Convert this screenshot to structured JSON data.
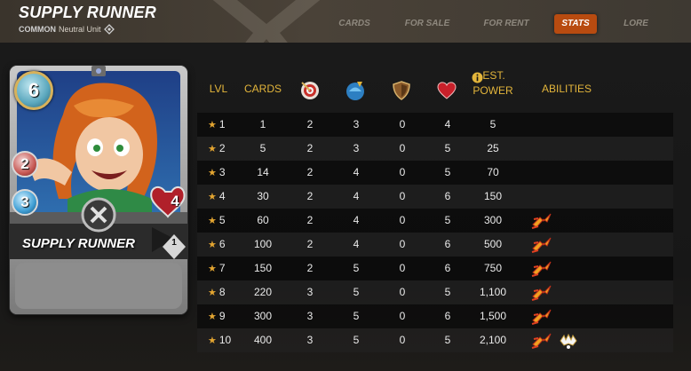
{
  "header": {
    "title": "SUPPLY RUNNER",
    "rarity": "COMMON",
    "unit_type": "Neutral Unit"
  },
  "tabs": [
    {
      "label": "CARDS",
      "active": false
    },
    {
      "label": "FOR SALE",
      "active": false
    },
    {
      "label": "FOR RENT",
      "active": false
    },
    {
      "label": "STATS",
      "active": true
    },
    {
      "label": "LORE",
      "active": false
    }
  ],
  "card": {
    "name": "SUPPLY RUNNER",
    "mana": "6",
    "melee": "2",
    "speed": "3",
    "health": "4",
    "level": "1"
  },
  "table": {
    "headers": {
      "lvl": "LVL",
      "cards": "CARDS",
      "power_line1": "EST.",
      "power_line2": "POWER",
      "abilities": "ABILITIES"
    },
    "header_icons": [
      "ranged-attack-icon",
      "speed-icon",
      "armor-icon",
      "health-icon",
      "info-icon"
    ],
    "rows": [
      {
        "lvl": "1",
        "cards": "1",
        "melee": "2",
        "speed": "3",
        "armor": "0",
        "health": "4",
        "power": "5",
        "abilities": []
      },
      {
        "lvl": "2",
        "cards": "5",
        "melee": "2",
        "speed": "3",
        "armor": "0",
        "health": "5",
        "power": "25",
        "abilities": []
      },
      {
        "lvl": "3",
        "cards": "14",
        "melee": "2",
        "speed": "4",
        "armor": "0",
        "health": "5",
        "power": "70",
        "abilities": []
      },
      {
        "lvl": "4",
        "cards": "30",
        "melee": "2",
        "speed": "4",
        "armor": "0",
        "health": "6",
        "power": "150",
        "abilities": []
      },
      {
        "lvl": "5",
        "cards": "60",
        "melee": "2",
        "speed": "4",
        "armor": "0",
        "health": "5",
        "power": "300",
        "abilities": [
          "swiftness-icon"
        ]
      },
      {
        "lvl": "6",
        "cards": "100",
        "melee": "2",
        "speed": "4",
        "armor": "0",
        "health": "6",
        "power": "500",
        "abilities": [
          "swiftness-icon"
        ]
      },
      {
        "lvl": "7",
        "cards": "150",
        "melee": "2",
        "speed": "5",
        "armor": "0",
        "health": "6",
        "power": "750",
        "abilities": [
          "swiftness-icon"
        ]
      },
      {
        "lvl": "8",
        "cards": "220",
        "melee": "3",
        "speed": "5",
        "armor": "0",
        "health": "5",
        "power": "1,100",
        "abilities": [
          "swiftness-icon"
        ]
      },
      {
        "lvl": "9",
        "cards": "300",
        "melee": "3",
        "speed": "5",
        "armor": "0",
        "health": "6",
        "power": "1,500",
        "abilities": [
          "swiftness-icon"
        ]
      },
      {
        "lvl": "10",
        "cards": "400",
        "melee": "3",
        "speed": "5",
        "armor": "0",
        "health": "5",
        "power": "2,100",
        "abilities": [
          "swiftness-icon",
          "resurrect-icon"
        ]
      }
    ]
  },
  "colors": {
    "accent_gold": "#e3b53b",
    "active_tab": "#b84b10",
    "star": "#e3a531"
  }
}
